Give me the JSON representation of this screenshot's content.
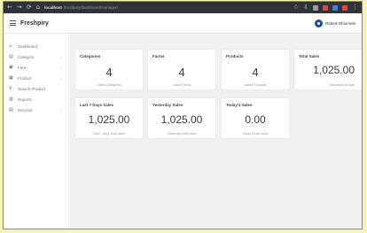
{
  "browser": {
    "nav_back": "←",
    "nav_forward": "→",
    "nav_reload": "⟳",
    "nav_home": "⌂",
    "url_host": "localhost",
    "url_path": "/freshpiry/dashboard/manager/",
    "actions": [
      "☆",
      "⇩",
      "⋮"
    ],
    "extension_colors": [
      "#9a9fa5",
      "#e04646",
      "#3f7ee8",
      "#e04646"
    ]
  },
  "app": {
    "brand": "Freshpiry",
    "user_name": "Robert Ohiomele"
  },
  "sidebar": {
    "items": [
      {
        "label": "Dashboard",
        "icon": "grid-icon",
        "glyph": "▫",
        "has_chevron": false
      },
      {
        "label": "Category",
        "icon": "tag-icon",
        "glyph": "▤",
        "has_chevron": true
      },
      {
        "label": "Farm",
        "icon": "farm-icon",
        "glyph": "▣",
        "has_chevron": true
      },
      {
        "label": "Product",
        "icon": "product-icon",
        "glyph": "▦",
        "has_chevron": true
      },
      {
        "label": "Search Product",
        "icon": "search-icon",
        "glyph": "⚲",
        "has_chevron": false
      },
      {
        "label": "Reports",
        "icon": "report-icon",
        "glyph": "▥",
        "has_chevron": false
      },
      {
        "label": "Records",
        "icon": "records-icon",
        "glyph": "▤",
        "has_chevron": true
      }
    ],
    "chevron": "›"
  },
  "cards": [
    {
      "title": "Categories",
      "value": "4",
      "sub": "Listed Categories"
    },
    {
      "title": "Farms",
      "value": "4",
      "sub": "Listed Farms"
    },
    {
      "title": "Products",
      "value": "4",
      "sub": "Listed Products"
    },
    {
      "title": "Total Sales",
      "value": "1,025.00",
      "sub": "Total sales to date"
    },
    {
      "title": "Last 7 Days Sales",
      "value": "1,025.00",
      "sub": "Last 7 days' total sales"
    },
    {
      "title": "Yesterday Sales",
      "value": "1,025.00",
      "sub": "Yesterday total sales"
    },
    {
      "title": "Today's Sales",
      "value": "0.00",
      "sub": "Today's total sales"
    }
  ]
}
